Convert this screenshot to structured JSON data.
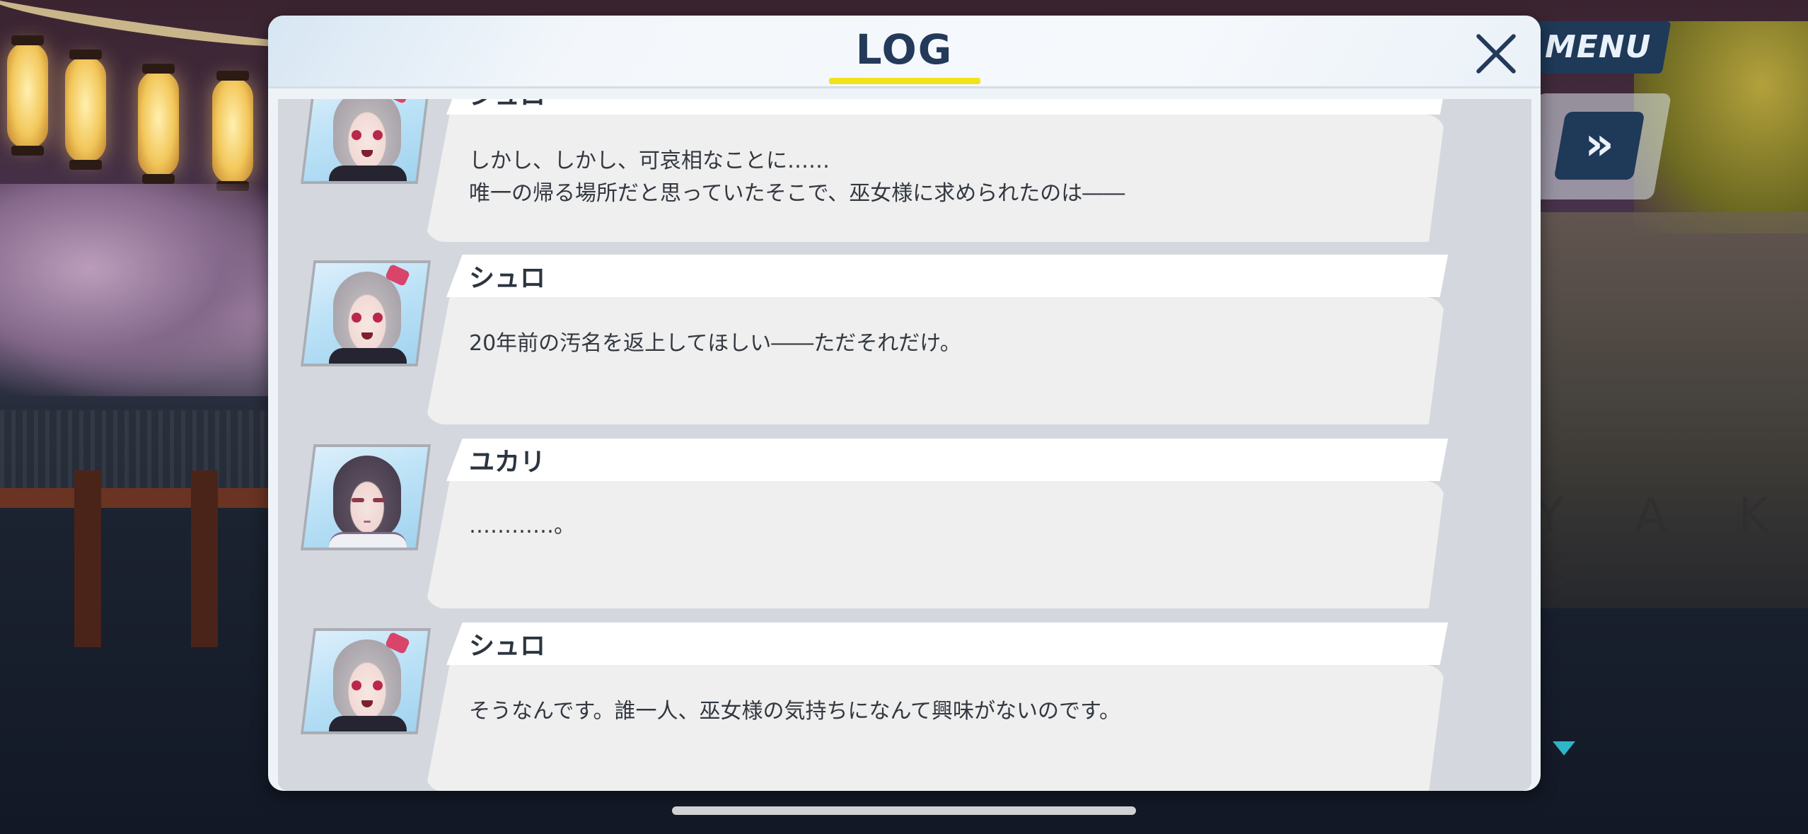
{
  "menu": {
    "label": "MENU"
  },
  "skip": {
    "label": "»"
  },
  "background": {
    "letters": "Y A K O"
  },
  "log": {
    "title": "LOG",
    "entries": [
      {
        "speaker": "シュロ",
        "lines": [
          "しかし、しかし、可哀相なことに……",
          "唯一の帰る場所だと思っていたそこで、巫女様に求められたのは――"
        ]
      },
      {
        "speaker": "シュロ",
        "lines": [
          "20年前の汚名を返上してほしい――ただそれだけ。"
        ]
      },
      {
        "speaker": "ユカリ",
        "lines": [
          "…………。"
        ]
      },
      {
        "speaker": "シュロ",
        "lines": [
          "そうなんです。誰一人、巫女様の気持ちになんて興味がないのです。"
        ]
      }
    ]
  }
}
